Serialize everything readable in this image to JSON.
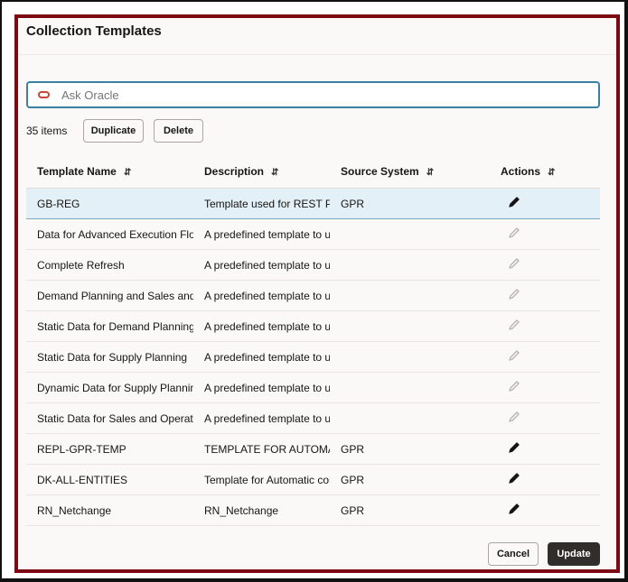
{
  "title": "Collection Templates",
  "search": {
    "placeholder": "Ask Oracle",
    "icon": "oracle-icon"
  },
  "count": "35 items",
  "toolbar": {
    "duplicate": "Duplicate",
    "delete": "Delete"
  },
  "columns": [
    "Template Name",
    "Description",
    "Source System",
    "Actions"
  ],
  "rows": [
    {
      "name": "GB-REG",
      "desc": "Template used for REST POC",
      "source": "GPR",
      "editable": true
    },
    {
      "name": "Data for Advanced Execution Flow",
      "desc": "A predefined template to use",
      "source": "",
      "editable": false
    },
    {
      "name": "Complete Refresh",
      "desc": "A predefined template to use",
      "source": "",
      "editable": false
    },
    {
      "name": "Demand Planning and Sales and Operations",
      "desc": "A predefined template to use",
      "source": "",
      "editable": false
    },
    {
      "name": "Static Data for Demand Planning",
      "desc": "A predefined template to use",
      "source": "",
      "editable": false
    },
    {
      "name": "Static Data for Supply Planning",
      "desc": "A predefined template to use",
      "source": "",
      "editable": false
    },
    {
      "name": "Dynamic Data for Supply Planning",
      "desc": "A predefined template to use",
      "source": "",
      "editable": false
    },
    {
      "name": "Static Data for Sales and Operations",
      "desc": "A predefined template to use",
      "source": "",
      "editable": false
    },
    {
      "name": "REPL-GPR-TEMP",
      "desc": "TEMPLATE FOR AUTOMATIC",
      "source": "GPR",
      "editable": true
    },
    {
      "name": "DK-ALL-ENTITIES",
      "desc": "Template for Automatic collection",
      "source": "GPR",
      "editable": true
    },
    {
      "name": "RN_Netchange",
      "desc": "RN_Netchange",
      "source": "GPR",
      "editable": true
    }
  ],
  "footer": {
    "cancel": "Cancel",
    "update": "Update"
  },
  "colors": {
    "frame": "#7d0a12",
    "selected_row": "#e4f0f7",
    "primary_button": "#312d2a"
  }
}
